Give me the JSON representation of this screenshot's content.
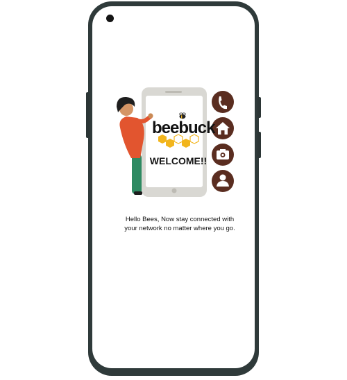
{
  "brand": {
    "name": "beebuck",
    "welcome": "WELCOME!!"
  },
  "tagline": {
    "line1": "Hello Bees, Now stay connected with",
    "line2": "your network no matter where you go."
  },
  "icons": [
    "phone-icon",
    "home-icon",
    "camera-icon",
    "user-icon"
  ],
  "colors": {
    "accent": "#f2b51c",
    "icon_circle": "#5a2d20",
    "phone_frame": "#2f3a3a"
  }
}
